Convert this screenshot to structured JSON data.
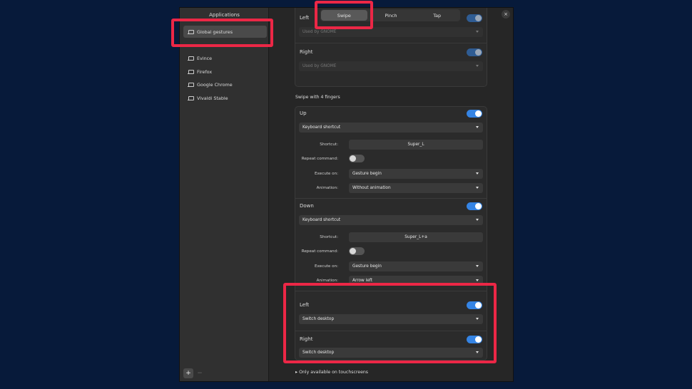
{
  "sidebar": {
    "title": "Applications",
    "items": [
      {
        "label": "Global gestures",
        "icon": "laptop-icon",
        "active": true
      },
      {
        "label": "Evince",
        "icon": "laptop-icon"
      },
      {
        "label": "Firefox",
        "icon": "laptop-icon"
      },
      {
        "label": "Google Chrome",
        "icon": "laptop-icon"
      },
      {
        "label": "Vivaldi Stable",
        "icon": "laptop-icon"
      }
    ],
    "add_label": "+",
    "remove_label": "−"
  },
  "tabs": [
    {
      "label": "Swipe",
      "active": true
    },
    {
      "label": "Pinch"
    },
    {
      "label": "Tap"
    }
  ],
  "close_label": "×",
  "three_finger": {
    "left": {
      "title": "Left",
      "dropdown": "Used by GNOME"
    },
    "right": {
      "title": "Right",
      "dropdown": "Used by GNOME"
    }
  },
  "four_finger": {
    "heading": "Swipe with 4 fingers",
    "up": {
      "title": "Up",
      "action": "Keyboard shortcut",
      "shortcut_label": "Shortcut:",
      "shortcut": "Super_L",
      "repeat_label": "Repeat command:",
      "execute_label": "Execute on:",
      "execute": "Gesture begin",
      "animation_label": "Animation:",
      "animation": "Without animation"
    },
    "down": {
      "title": "Down",
      "action": "Keyboard shortcut",
      "shortcut_label": "Shortcut:",
      "shortcut": "Super_L+a",
      "repeat_label": "Repeat command:",
      "execute_label": "Execute on:",
      "execute": "Gesture begin",
      "animation_label": "Animation:",
      "animation": "Arrow left"
    },
    "left": {
      "title": "Left",
      "action": "Switch desktop"
    },
    "right": {
      "title": "Right",
      "action": "Switch desktop"
    }
  },
  "footer_note": "Only available on touchscreens",
  "colors": {
    "accent": "#3584e4",
    "highlight": "#ec2746",
    "background": "#071a3a"
  }
}
